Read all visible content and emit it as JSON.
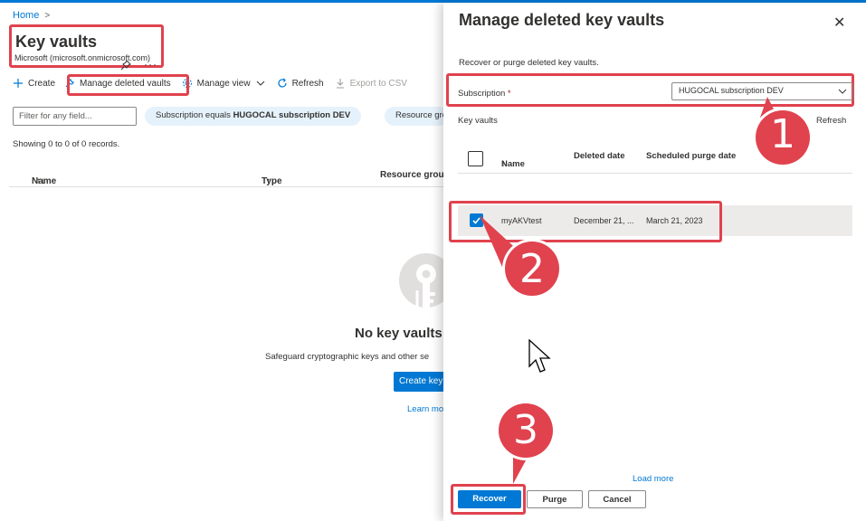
{
  "accent": "#0078d4",
  "highlight_color": "#e0424e",
  "breadcrumb": {
    "home": "Home",
    "chevron": ">"
  },
  "header": {
    "title": "Key vaults",
    "subtitle": "Microsoft (microsoft.onmicrosoft.com)",
    "pin_icon": "pin-icon",
    "more": "···"
  },
  "toolbar": {
    "create": "Create",
    "manage_deleted": "Manage deleted vaults",
    "manage_view": "Manage view",
    "refresh": "Refresh",
    "export_csv": "Export to CSV"
  },
  "filters": {
    "placeholder": "Filter for any field...",
    "subscription_prefix": "Subscription equals ",
    "subscription_value": "HUGOCAL subscription DEV",
    "resource_group_pill": "Resource gro"
  },
  "records": "Showing 0 to 0 of 0 records.",
  "grid": {
    "columns": [
      "Name",
      "Type",
      "Resource group"
    ],
    "sort_name": "↑↓",
    "sort_type": "↑↓"
  },
  "empty": {
    "title": "No key vaults",
    "description": "Safeguard cryptographic keys and other se",
    "create_button": "Create key",
    "learn_more": "Learn mo"
  },
  "panel": {
    "title": "Manage deleted key vaults",
    "close": "✕",
    "description": "Recover or purge deleted key vaults.",
    "subscription_label": "Subscription",
    "required_mark": "*",
    "subscription_value": "HUGOCAL subscription DEV",
    "key_vaults_label": "Key vaults",
    "refresh": "Refresh",
    "columns": {
      "name": "Name",
      "name_sort": "↑",
      "deleted_date": "Deleted date",
      "purge_date": "Scheduled purge date"
    },
    "rows": [
      {
        "name": "myAKVtest",
        "deleted_date": "December 21, ...",
        "purge_date": "March 21, 2023",
        "checked": true
      }
    ],
    "load_more": "Load more",
    "buttons": {
      "recover": "Recover",
      "purge": "Purge",
      "cancel": "Cancel"
    }
  },
  "callouts": [
    "1",
    "2",
    "3"
  ]
}
